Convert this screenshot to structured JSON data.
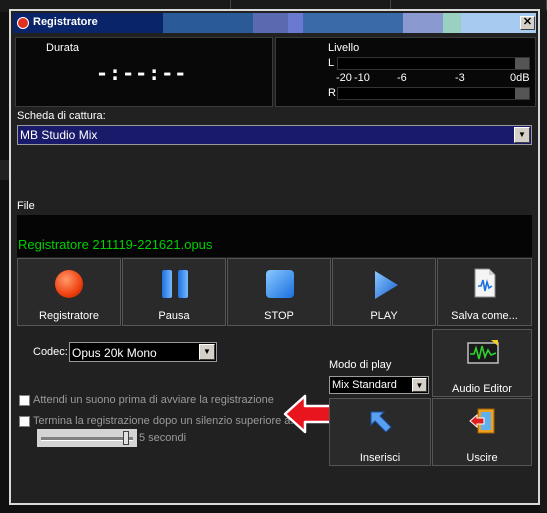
{
  "window": {
    "title": "Registratore",
    "close_glyph": "✕"
  },
  "durata": {
    "label": "Durata",
    "value": "-:--:--"
  },
  "livello": {
    "label": "Livello",
    "left_channel": "L",
    "right_channel": "R",
    "scale": [
      "-20",
      "-10",
      "-6",
      "-3",
      "0dB"
    ]
  },
  "capture": {
    "label": "Scheda di cattura:",
    "value": "MB Studio Mix"
  },
  "file": {
    "label": "File",
    "name": "Registratore 211119-221621.opus"
  },
  "transport": [
    {
      "label": "Registratore",
      "icon": "record-icon"
    },
    {
      "label": "Pausa",
      "icon": "pause-icon"
    },
    {
      "label": "STOP",
      "icon": "stop-icon"
    },
    {
      "label": "PLAY",
      "icon": "play-icon"
    },
    {
      "label": "Salva come...",
      "icon": "audio-file-icon"
    }
  ],
  "codec": {
    "label": "Codec:",
    "value": "Opus 20k Mono"
  },
  "play_mode": {
    "label": "Modo di play",
    "value": "Mix Standard"
  },
  "options": {
    "wait_sound": "Attendi un suono prima di avviare la registrazione",
    "stop_silence": "Termina la registrazione dopo un silenzio superiore a...",
    "silence_value": "5 secondi"
  },
  "actions": {
    "audio_editor": "Audio Editor",
    "inserisci": "Inserisci",
    "uscire": "Uscire"
  },
  "colors": {
    "file_text": "#00d000",
    "accent_arrow": "#e8141e",
    "title_gradient_start": "#0a246a"
  }
}
